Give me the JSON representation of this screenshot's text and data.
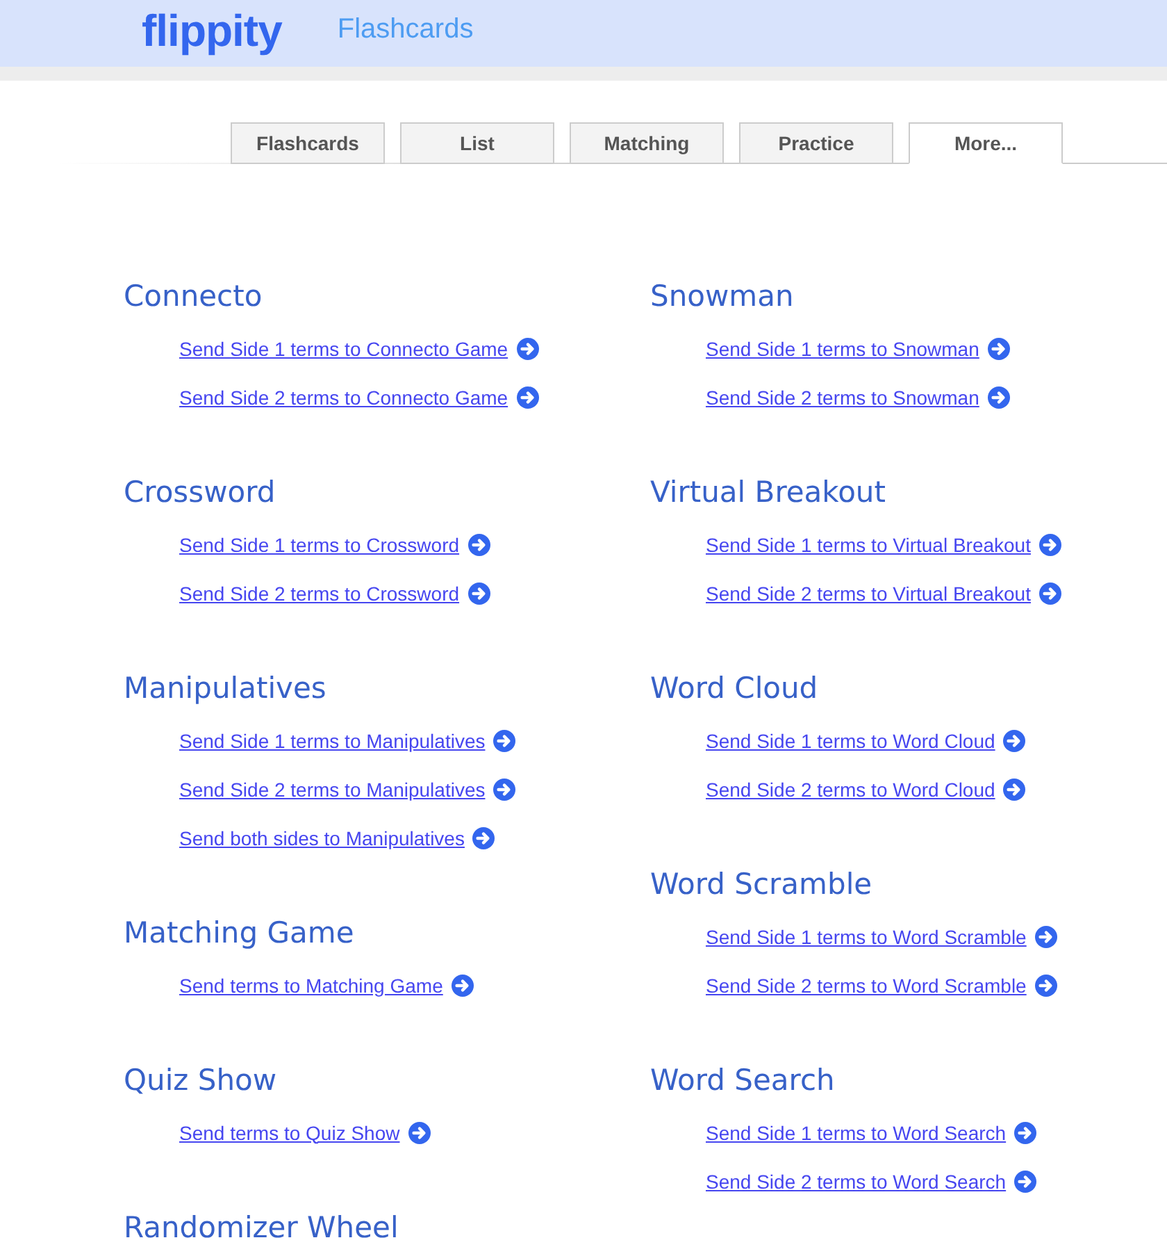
{
  "header": {
    "logo": "flippity",
    "title": "Flashcards"
  },
  "tabs": [
    {
      "label": "Flashcards",
      "selected": false
    },
    {
      "label": "List",
      "selected": false
    },
    {
      "label": "Matching",
      "selected": false
    },
    {
      "label": "Practice",
      "selected": false
    },
    {
      "label": "More...",
      "selected": true
    }
  ],
  "columns": [
    {
      "sections": [
        {
          "heading": "Connecto",
          "links": [
            "Send Side 1 terms to Connecto Game",
            "Send Side 2 terms to Connecto Game"
          ]
        },
        {
          "heading": "Crossword",
          "links": [
            "Send Side 1 terms to Crossword",
            "Send Side 2 terms to Crossword"
          ]
        },
        {
          "heading": "Manipulatives",
          "links": [
            "Send Side 1 terms to Manipulatives",
            "Send Side 2 terms to Manipulatives",
            "Send both sides to Manipulatives"
          ]
        },
        {
          "heading": "Matching Game",
          "links": [
            "Send terms to Matching Game"
          ]
        },
        {
          "heading": "Quiz Show",
          "links": [
            "Send terms to Quiz Show"
          ]
        },
        {
          "heading": "Randomizer Wheel"
        }
      ]
    },
    {
      "sections": [
        {
          "heading": "Snowman",
          "links": [
            "Send Side 1 terms to Snowman",
            "Send Side 2 terms to Snowman"
          ]
        },
        {
          "heading": "Virtual Breakout",
          "links": [
            "Send Side 1 terms to Virtual Breakout",
            "Send Side 2 terms to Virtual Breakout"
          ]
        },
        {
          "heading": "Word Cloud",
          "links": [
            "Send Side 1 terms to Word Cloud",
            "Send Side 2 terms to Word Cloud"
          ]
        },
        {
          "heading": "Word Scramble",
          "links": [
            "Send Side 1 terms to Word Scramble",
            "Send Side 2 terms to Word Scramble"
          ]
        },
        {
          "heading": "Word Search",
          "links": [
            "Send Side 1 terms to Word Search",
            "Send Side 2 terms to Word Search"
          ]
        }
      ]
    }
  ]
}
